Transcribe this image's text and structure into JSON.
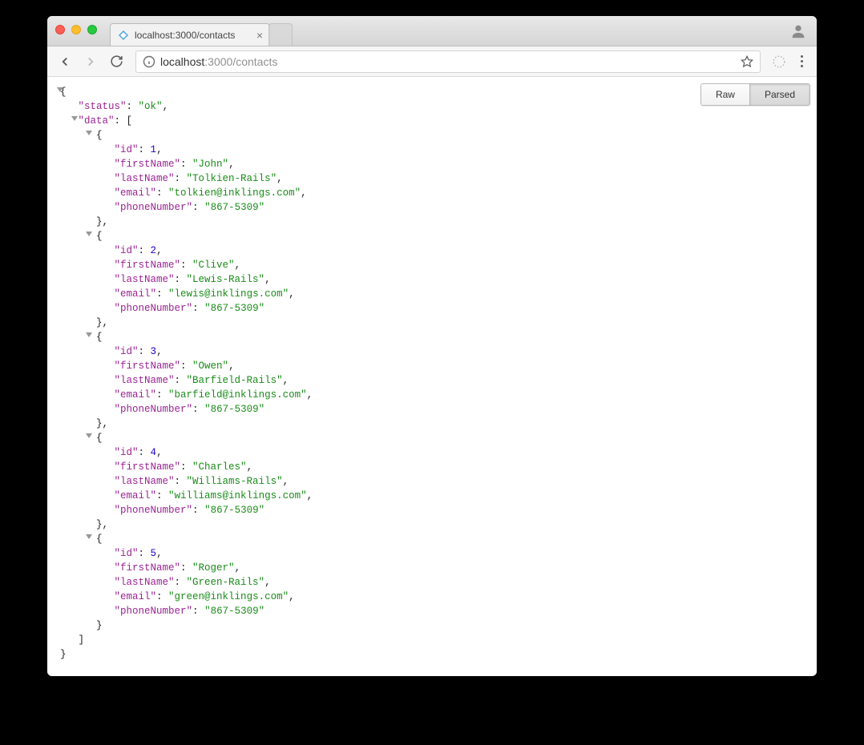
{
  "tab": {
    "title": "localhost:3000/contacts"
  },
  "url": {
    "prefix": "localhost",
    "port": ":3000",
    "path": "/contacts"
  },
  "toggle": {
    "raw": "Raw",
    "parsed": "Parsed"
  },
  "json": {
    "status_key": "\"status\"",
    "status_val": "\"ok\"",
    "data_key": "\"data\"",
    "fields": {
      "id": "\"id\"",
      "firstName": "\"firstName\"",
      "lastName": "\"lastName\"",
      "email": "\"email\"",
      "phoneNumber": "\"phoneNumber\""
    },
    "records": [
      {
        "id": "1",
        "firstName": "\"John\"",
        "lastName": "\"Tolkien-Rails\"",
        "email": "\"tolkien@inklings.com\"",
        "phoneNumber": "\"867-5309\""
      },
      {
        "id": "2",
        "firstName": "\"Clive\"",
        "lastName": "\"Lewis-Rails\"",
        "email": "\"lewis@inklings.com\"",
        "phoneNumber": "\"867-5309\""
      },
      {
        "id": "3",
        "firstName": "\"Owen\"",
        "lastName": "\"Barfield-Rails\"",
        "email": "\"barfield@inklings.com\"",
        "phoneNumber": "\"867-5309\""
      },
      {
        "id": "4",
        "firstName": "\"Charles\"",
        "lastName": "\"Williams-Rails\"",
        "email": "\"williams@inklings.com\"",
        "phoneNumber": "\"867-5309\""
      },
      {
        "id": "5",
        "firstName": "\"Roger\"",
        "lastName": "\"Green-Rails\"",
        "email": "\"green@inklings.com\"",
        "phoneNumber": "\"867-5309\""
      }
    ]
  }
}
